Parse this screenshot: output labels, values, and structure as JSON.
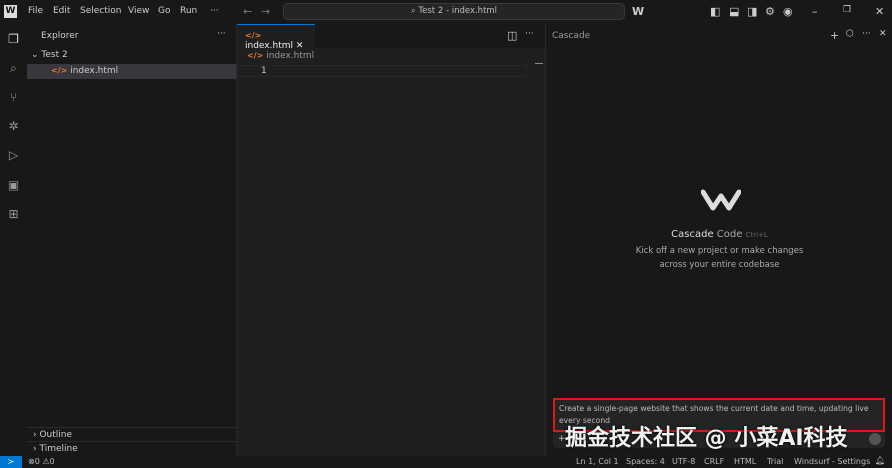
{
  "titlebar": {
    "menus": [
      "File",
      "Edit",
      "Selection",
      "View",
      "Go",
      "Run",
      "···"
    ],
    "search": "Test 2 - index.html",
    "logo": "W"
  },
  "sidebar": {
    "title": "Explorer",
    "more": "···",
    "folder": "Test 2",
    "file": "index.html",
    "outline": "Outline",
    "timeline": "Timeline"
  },
  "editor": {
    "tab": "index.html",
    "breadcrumb": "index.html",
    "line_number": "1"
  },
  "cascade": {
    "title": "Cascade",
    "heading": "Cascade",
    "heading_mode": "Code",
    "shortcut": "Ctrl+L",
    "subtitle1": "Kick off a new project or make changes",
    "subtitle2": "across your entire codebase",
    "prompt": "Create a single-page website that shows the current date and time, updating live every second"
  },
  "status": {
    "errors": "0",
    "warnings": "0",
    "position": "Ln 1, Col 1",
    "spaces": "Spaces: 4",
    "encoding": "UTF-8",
    "eol": "CRLF",
    "language": "HTML",
    "plan": "Trial",
    "settings": "Windsurf - Settings"
  },
  "watermark": "掘金技术社区 @ 小菜AI科技"
}
